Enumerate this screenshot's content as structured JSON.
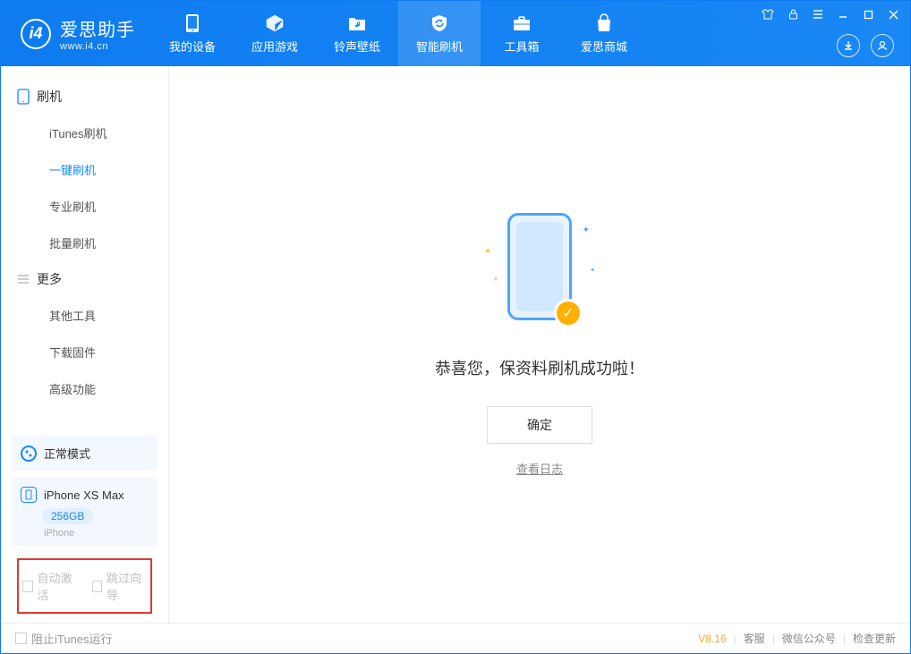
{
  "app": {
    "name": "爱思助手",
    "url": "www.i4.cn"
  },
  "tabs": {
    "device": "我的设备",
    "apps": "应用游戏",
    "ring": "铃声壁纸",
    "flash": "智能刷机",
    "tools": "工具箱",
    "store": "爱思商城"
  },
  "sidebar": {
    "group_flash": "刷机",
    "items_flash": [
      "iTunes刷机",
      "一键刷机",
      "专业刷机",
      "批量刷机"
    ],
    "group_more": "更多",
    "items_more": [
      "其他工具",
      "下载固件",
      "高级功能"
    ]
  },
  "mode": {
    "label": "正常模式"
  },
  "device": {
    "name": "iPhone XS Max",
    "storage": "256GB",
    "type": "iPhone"
  },
  "options": {
    "auto_activate": "自动激活",
    "skip_guide": "跳过向导"
  },
  "main": {
    "success": "恭喜您，保资料刷机成功啦！",
    "ok": "确定",
    "view_log": "查看日志"
  },
  "footer": {
    "stop_itunes": "阻止iTunes运行",
    "version": "V8.16",
    "cs": "客服",
    "wechat": "微信公众号",
    "update": "检查更新"
  }
}
